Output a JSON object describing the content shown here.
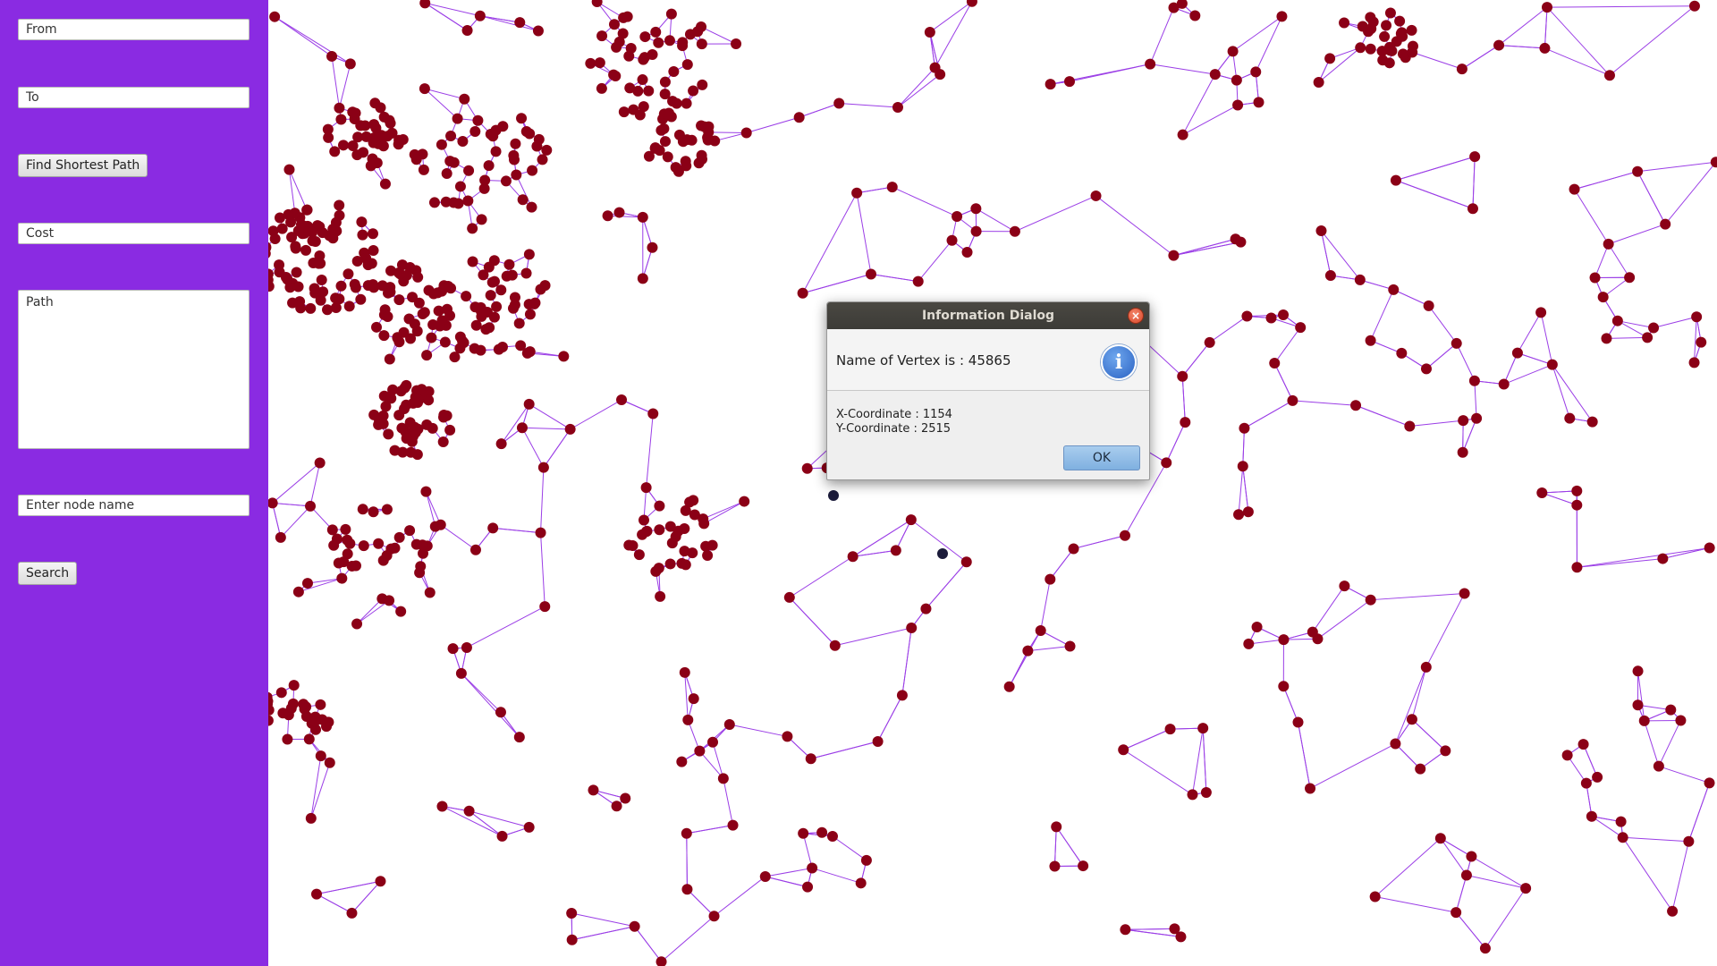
{
  "sidebar": {
    "from_placeholder": "From",
    "to_placeholder": "To",
    "find_button": "Find Shortest Path",
    "cost_placeholder": "Cost",
    "path_placeholder": "Path",
    "node_placeholder": "Enter node name",
    "search_button": "Search",
    "background_color": "#8a2be2"
  },
  "dialog": {
    "title": "Information Dialog",
    "header": "Name of Vertex is : 45865",
    "x_text": "X-Coordinate : 1154",
    "y_text": "Y-Coordinate : 2515",
    "ok_label": "OK",
    "close_icon": "close-icon",
    "info_icon": "info-icon"
  },
  "graph": {
    "edge_color": "#9b3ee6",
    "node_color": "#8b0016",
    "highlight_color": "#1b1b3a"
  }
}
